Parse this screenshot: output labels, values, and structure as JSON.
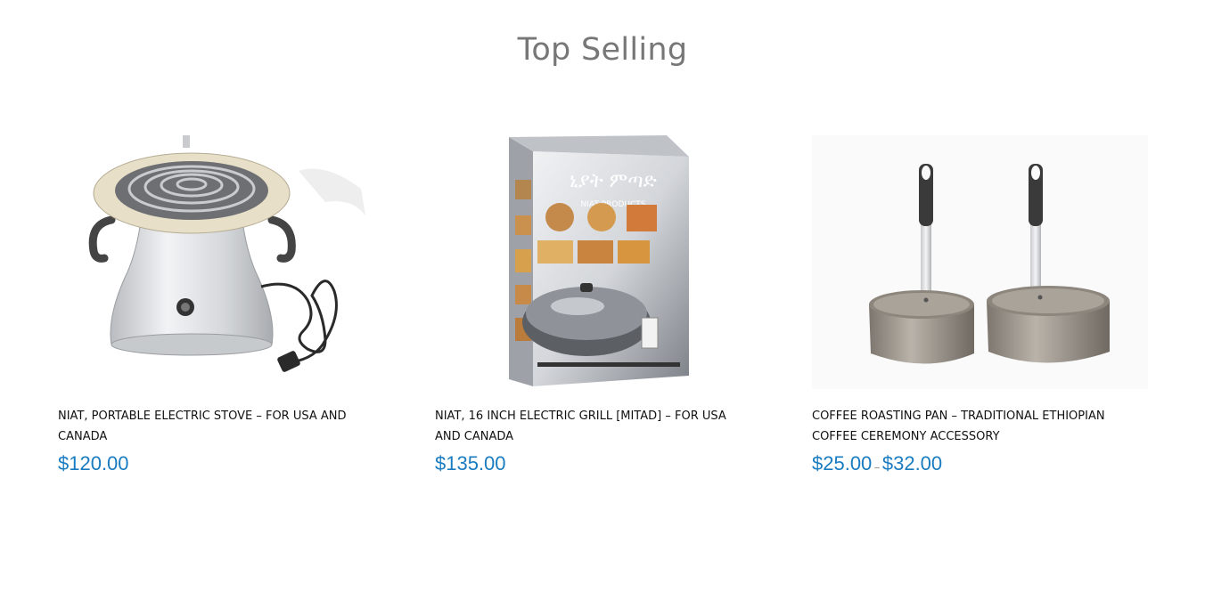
{
  "section": {
    "title": "Top Selling"
  },
  "products": [
    {
      "name": "NIAT, PORTABLE ELECTRIC STOVE – FOR USA AND CANADA",
      "price": "$120.00",
      "image_icon": "electric-stove-image"
    },
    {
      "name": "NIAT, 16 INCH ELECTRIC GRILL [MITAD] – FOR USA AND CANADA",
      "price": "$135.00",
      "box_title": "ኒያት ምጣድ",
      "box_subtitle": "NIAT PRODUCTS",
      "image_icon": "electric-grill-box-image"
    },
    {
      "name": "COFFEE ROASTING PAN – TRADITIONAL ETHIOPIAN COFFEE CEREMONY ACCESSORY",
      "price_min": "$25.00",
      "price_sep": "–",
      "price_max": "$32.00",
      "image_icon": "coffee-roasting-pan-image"
    }
  ],
  "colors": {
    "title": "#777777",
    "price": "#1a7cc0",
    "name": "#111111"
  }
}
